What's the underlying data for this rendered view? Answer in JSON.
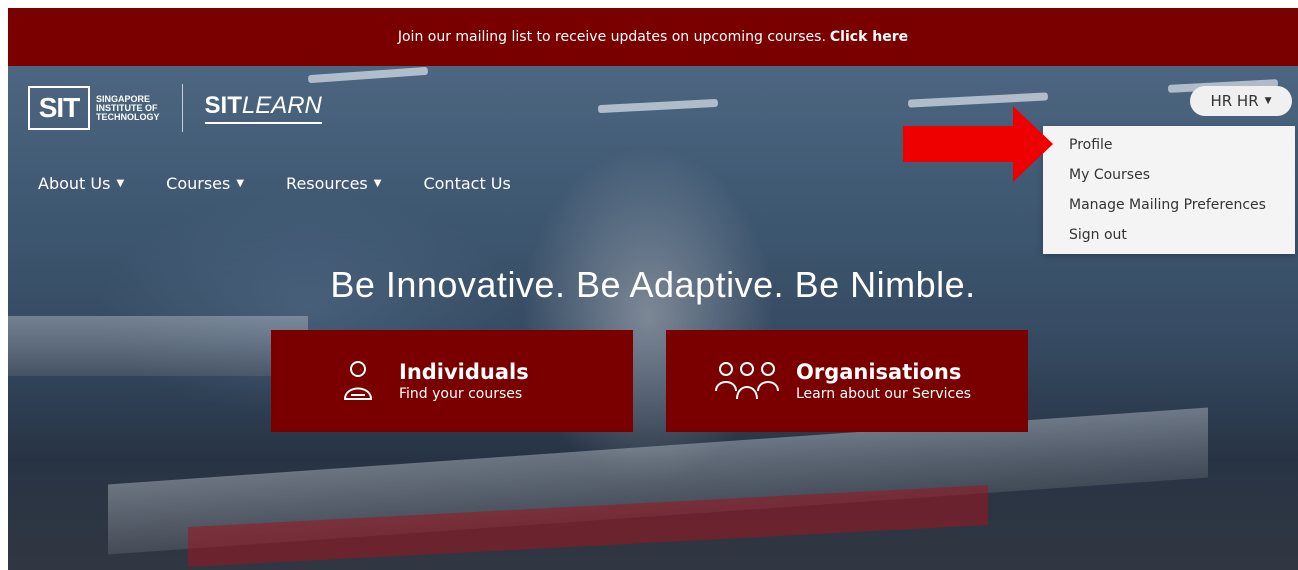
{
  "banner": {
    "text": "Join our mailing list to receive updates on upcoming courses.",
    "link_label": "Click here"
  },
  "logo": {
    "sit_mark": "SIT",
    "institute_line1": "SINGAPORE",
    "institute_line2": "INSTITUTE OF",
    "institute_line3": "TECHNOLOGY",
    "brand_bold": "SIT",
    "brand_italic": "LEARN"
  },
  "nav": {
    "items": [
      {
        "label": "About Us",
        "has_caret": true
      },
      {
        "label": "Courses",
        "has_caret": true
      },
      {
        "label": "Resources",
        "has_caret": true
      },
      {
        "label": "Contact Us",
        "has_caret": false
      }
    ]
  },
  "user_menu": {
    "button_label": "HR HR",
    "items": [
      "Profile",
      "My Courses",
      "Manage Mailing Preferences",
      "Sign out"
    ]
  },
  "hero": {
    "tagline": "Be Innovative. Be Adaptive. Be Nimble."
  },
  "cards": [
    {
      "title": "Individuals",
      "subtitle": "Find your courses",
      "icon": "person-icon"
    },
    {
      "title": "Organisations",
      "subtitle": "Learn about our Services",
      "icon": "people-group-icon"
    }
  ],
  "colors": {
    "brand_red": "#7a0000",
    "arrow_red": "#ee0000",
    "dropdown_bg": "#f4f4f4"
  }
}
